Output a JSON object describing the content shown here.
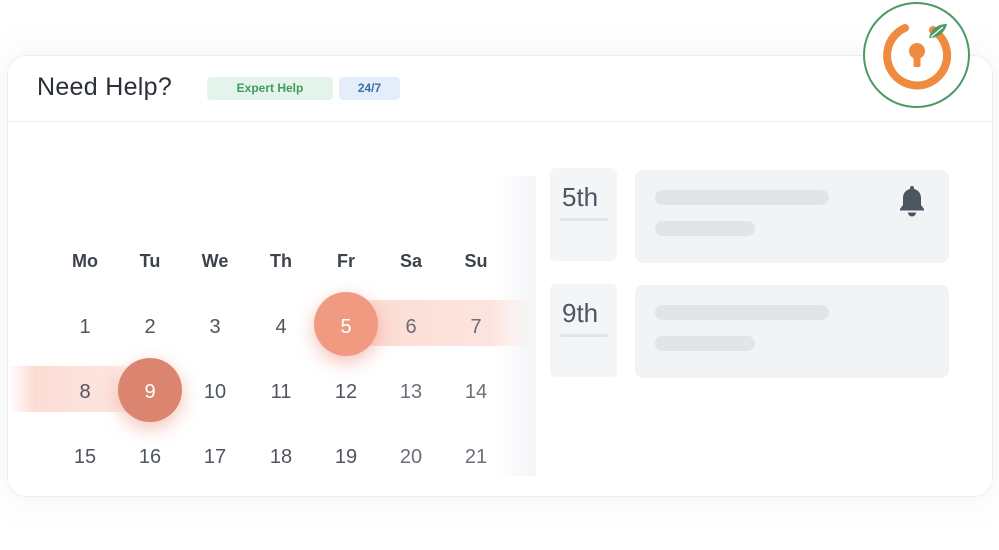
{
  "header": {
    "title": "Need Help?",
    "badges": [
      {
        "label": "Expert Help",
        "color": "#3f9a5e",
        "background": "#e5f4ea"
      },
      {
        "label": "24/7",
        "color": "#3d6ea8",
        "background": "#e3eefa"
      }
    ]
  },
  "logo": {
    "icon": "keyhole-power-icon",
    "accent": "#f08a3e",
    "ring": "#4a9a63"
  },
  "calendar": {
    "weekdays": [
      "Mo",
      "Tu",
      "We",
      "Th",
      "Fr",
      "Sa",
      "Su"
    ],
    "weeks": [
      [
        "1",
        "2",
        "3",
        "4",
        "5",
        "6",
        "7"
      ],
      [
        "8",
        "9",
        "10",
        "11",
        "12",
        "13",
        "14"
      ],
      [
        "15",
        "16",
        "17",
        "18",
        "19",
        "20",
        "21"
      ]
    ],
    "selected_days": [
      "5",
      "9"
    ],
    "highlight_color": "#f19a82"
  },
  "events": [
    {
      "date": "5th",
      "icon": "bell-icon"
    },
    {
      "date": "9th",
      "icon": "none"
    }
  ]
}
